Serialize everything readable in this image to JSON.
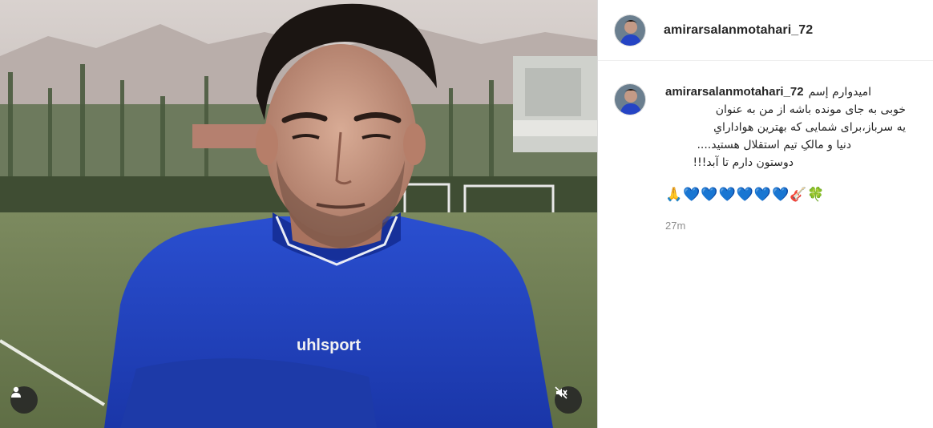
{
  "post": {
    "username": "amirarsalanmotahari_72",
    "shirt_brand": "uhlsport",
    "caption": {
      "line1": "امیدوارم إسم",
      "line2": "خوبی به جای مونده باشه از من به عنوان",
      "line3": "یه سرباز،برای شمایی که بهترین هوادارایِ",
      "line4": "دنیا و مالکِ تیم استقلال هستید....",
      "line5": "دوستون دارم تا آبد!!!"
    },
    "emojis": {
      "hands": "🙏",
      "hearts": [
        "💙",
        "💙",
        "💙",
        "💙",
        "💙",
        "💙"
      ],
      "guitar": "🎸",
      "clover": "🍀"
    },
    "timestamp": "27m"
  },
  "colors": {
    "jersey": "#1f3fbf",
    "link_blue": "#1877f2",
    "text": "#262626",
    "muted": "#8e8e8e"
  },
  "icons": {
    "tag": "person-icon",
    "mute": "speaker-muted-icon"
  }
}
